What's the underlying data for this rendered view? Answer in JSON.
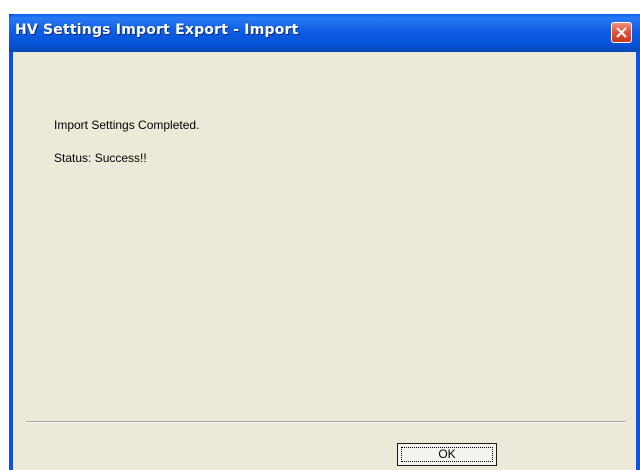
{
  "window": {
    "title": "HV Settings Import Export - Import"
  },
  "titlebar": {
    "close_icon": "close-icon"
  },
  "content": {
    "message": "Import Settings Completed.",
    "status": "Status: Success!!"
  },
  "buttons": {
    "ok_label": "OK"
  },
  "colors": {
    "titlebar": "#0552d6",
    "client_background": "#ece9d8",
    "close_button": "#e2553a"
  }
}
